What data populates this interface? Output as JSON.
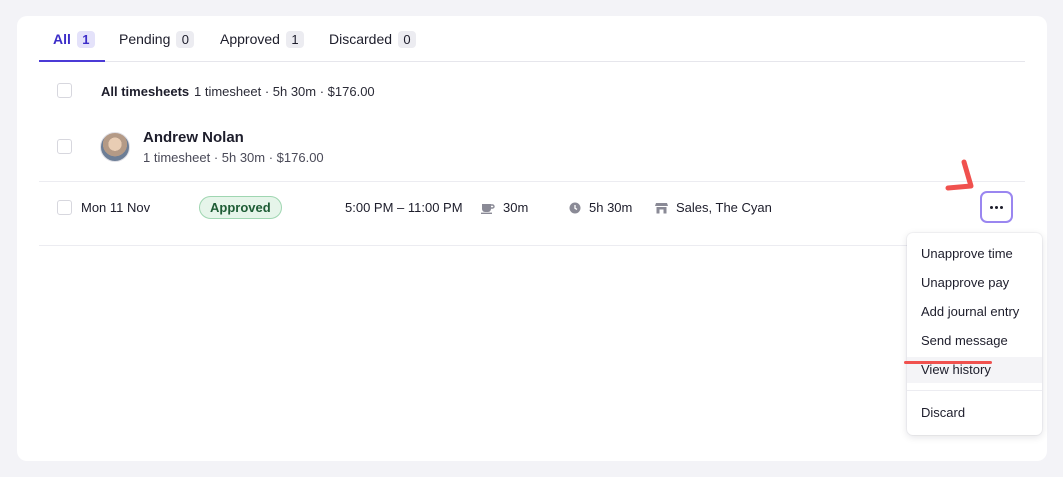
{
  "tabs": [
    {
      "label": "All",
      "count": "1"
    },
    {
      "label": "Pending",
      "count": "0"
    },
    {
      "label": "Approved",
      "count": "1"
    },
    {
      "label": "Discarded",
      "count": "0"
    }
  ],
  "summary": {
    "label": "All timesheets",
    "text": "1 timesheet · 5h 30m · $176.00"
  },
  "person": {
    "name": "Andrew Nolan",
    "sub": "1 timesheet · 5h 30m · $176.00"
  },
  "row": {
    "date": "Mon 11 Nov",
    "status": "Approved",
    "time": "5:00 PM – 11:00 PM",
    "break": "30m",
    "duration": "5h 30m",
    "location": "Sales, The Cyan",
    "icons": [
      "coffee-icon",
      "clock-icon",
      "store-icon",
      "more-icon"
    ]
  },
  "menu": {
    "items": [
      "Unapprove time",
      "Unapprove pay",
      "Add journal entry",
      "Send message",
      "View history",
      "Discard"
    ]
  },
  "colors": {
    "accent": "#4b3ad6",
    "approved_bg": "#e6f5ea",
    "approved_text": "#1e5c35",
    "annotation": "#f0514e"
  }
}
